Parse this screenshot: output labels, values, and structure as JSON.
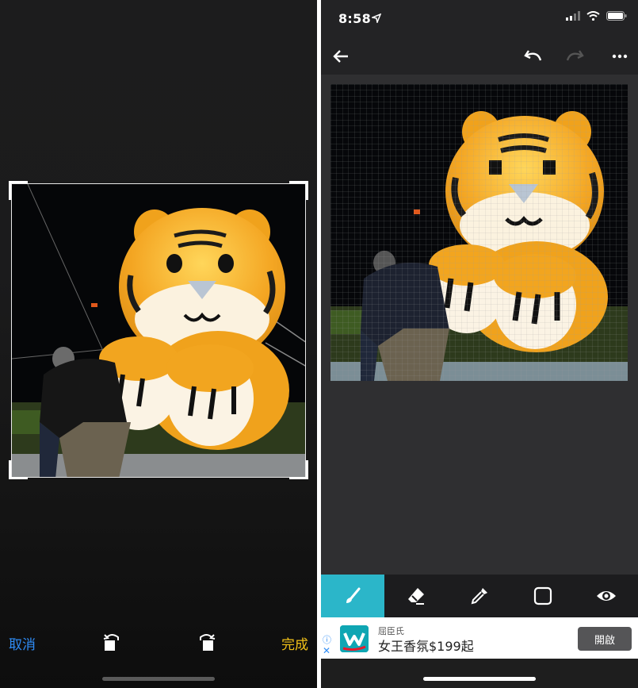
{
  "crop_screen": {
    "cancel_label": "取消",
    "done_label": "完成",
    "rotate_left_icon": "rotate-left-icon",
    "rotate_right_icon": "rotate-right-icon"
  },
  "status_bar": {
    "time": "8:58"
  },
  "editor_header": {
    "icons": [
      "back-arrow-icon",
      "undo-icon",
      "redo-icon",
      "more-icon"
    ]
  },
  "tools": [
    {
      "icon": "brush-icon",
      "active": true
    },
    {
      "icon": "eraser-icon",
      "active": false
    },
    {
      "icon": "eyedropper-icon",
      "active": false
    },
    {
      "icon": "square-icon",
      "active": false
    },
    {
      "icon": "eye-icon",
      "active": false
    }
  ],
  "ad": {
    "brand": "屈臣氏",
    "headline": "女王香氛$199起",
    "cta": "開啟"
  },
  "colors": {
    "accent_blue": "#2f8cf5",
    "done_yellow": "#f2c218",
    "tool_active": "#2bb6c9",
    "tiger_orange": "#f2a51f"
  }
}
